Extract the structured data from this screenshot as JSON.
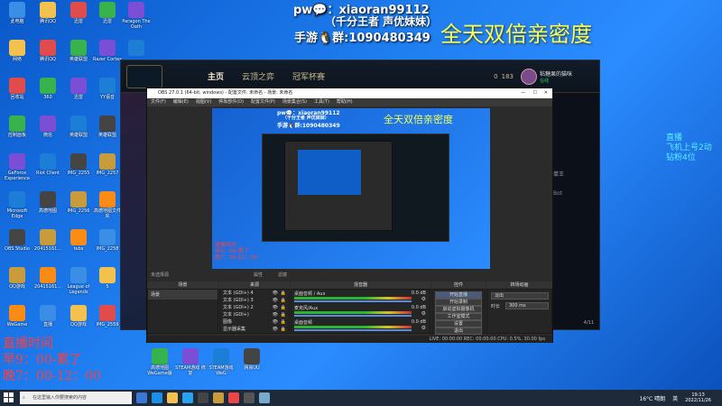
{
  "overlay": {
    "pw_line": "pw💬：xiaoran99112",
    "sub_line": "（千分王者 声优妹妹）",
    "qq_line": "手游🐧群:1090480349",
    "big_text": "全天双倍亲密度",
    "live_title": "直播时间",
    "live_morning": "早9：00-累了",
    "live_evening": "晚7：00-12：00",
    "right_note_1": "直播",
    "right_note_2": "飞机上号2动",
    "right_note_3": "钻粉4位"
  },
  "desktop": {
    "col1": [
      "此电脑",
      "网络",
      "回收站",
      "控制面板",
      "GeForce Experience",
      "Microsoft Edge",
      "OBS Studio",
      "QQ游戏",
      "WeGame"
    ],
    "col2": [
      "腾讯QQ",
      "腾讯QQ",
      "360",
      "微信",
      "Riot Client",
      "高德地图",
      "20415161...",
      "20415161...",
      "直播"
    ],
    "col3": [
      "迅雷",
      "英雄联盟",
      "迅雷",
      "英雄联盟",
      "IMG_2255",
      "IMG_2256",
      "tebs",
      "League of Legends",
      "QQ游戏"
    ],
    "col4": [
      "迅雷",
      "Razer Cortex",
      "YY语音",
      "英雄联盟",
      "IMG_2257",
      "高德地图文件夹",
      "IMG_2258",
      "5",
      "IMG_2559"
    ],
    "col5": [
      "Paragon The Oath",
      ""
    ],
    "bottom_row": [
      "高德地图 WeGame版",
      "STEAM游戏 修复",
      "STEAM游戏 WeG",
      "网易UU"
    ]
  },
  "lol": {
    "tabs": [
      "主页",
      "云顶之弈",
      "冠军杯赛"
    ],
    "level": "0",
    "currency": "183",
    "username": "粘糖果的猫咪",
    "status": "在线",
    "side_items": [
      "单王",
      "Bot"
    ],
    "footer_tag": "4/11"
  },
  "obs": {
    "title": "OBS 27.0.1 (64-bit, windows) - 配置文件: 未命名 - 场景: 未命名",
    "menu": [
      "文件(F)",
      "编辑(E)",
      "视图(V)",
      "停靠部件(D)",
      "配置文件(P)",
      "场景集合(S)",
      "工具(T)",
      "帮助(H)"
    ],
    "source_label": "未选择源",
    "props_btn": "属性",
    "filters_btn": "滤镜",
    "scenes_hdr": "场景",
    "sources_hdr": "来源",
    "mixer_hdr": "混音器",
    "transitions_hdr": "转场动画",
    "controls_hdr": "控件",
    "scene_item": "场景",
    "sources": [
      "文本 (GDI+) 4",
      "文本 (GDI+) 3",
      "文本 (GDI+) 2",
      "文本 (GDI+)",
      "图像",
      "显示器采集"
    ],
    "mixer_items": [
      {
        "name": "桌面音频 / Aux",
        "db": "0.0 dB"
      },
      {
        "name": "麦克风/Aux",
        "db": "0.0 dB"
      },
      {
        "name": "桌面音频",
        "db": "0.0 dB"
      }
    ],
    "controls": [
      "开始直播",
      "开始录制",
      "启动虚拟摄像机",
      "工作室模式",
      "设置",
      "退出"
    ],
    "transition": "淡出",
    "duration_label": "时长",
    "duration_value": "300 ms",
    "status_bar": "LIVE: 00:00:00    REC: 00:00:00    CPU: 0.5%, 30.00 fps"
  },
  "taskbar": {
    "search_placeholder": "在这里输入你要搜索的内容",
    "weather": "16°C 晴朗",
    "time": "19:13",
    "date": "2022/11/26",
    "lang": "英"
  }
}
